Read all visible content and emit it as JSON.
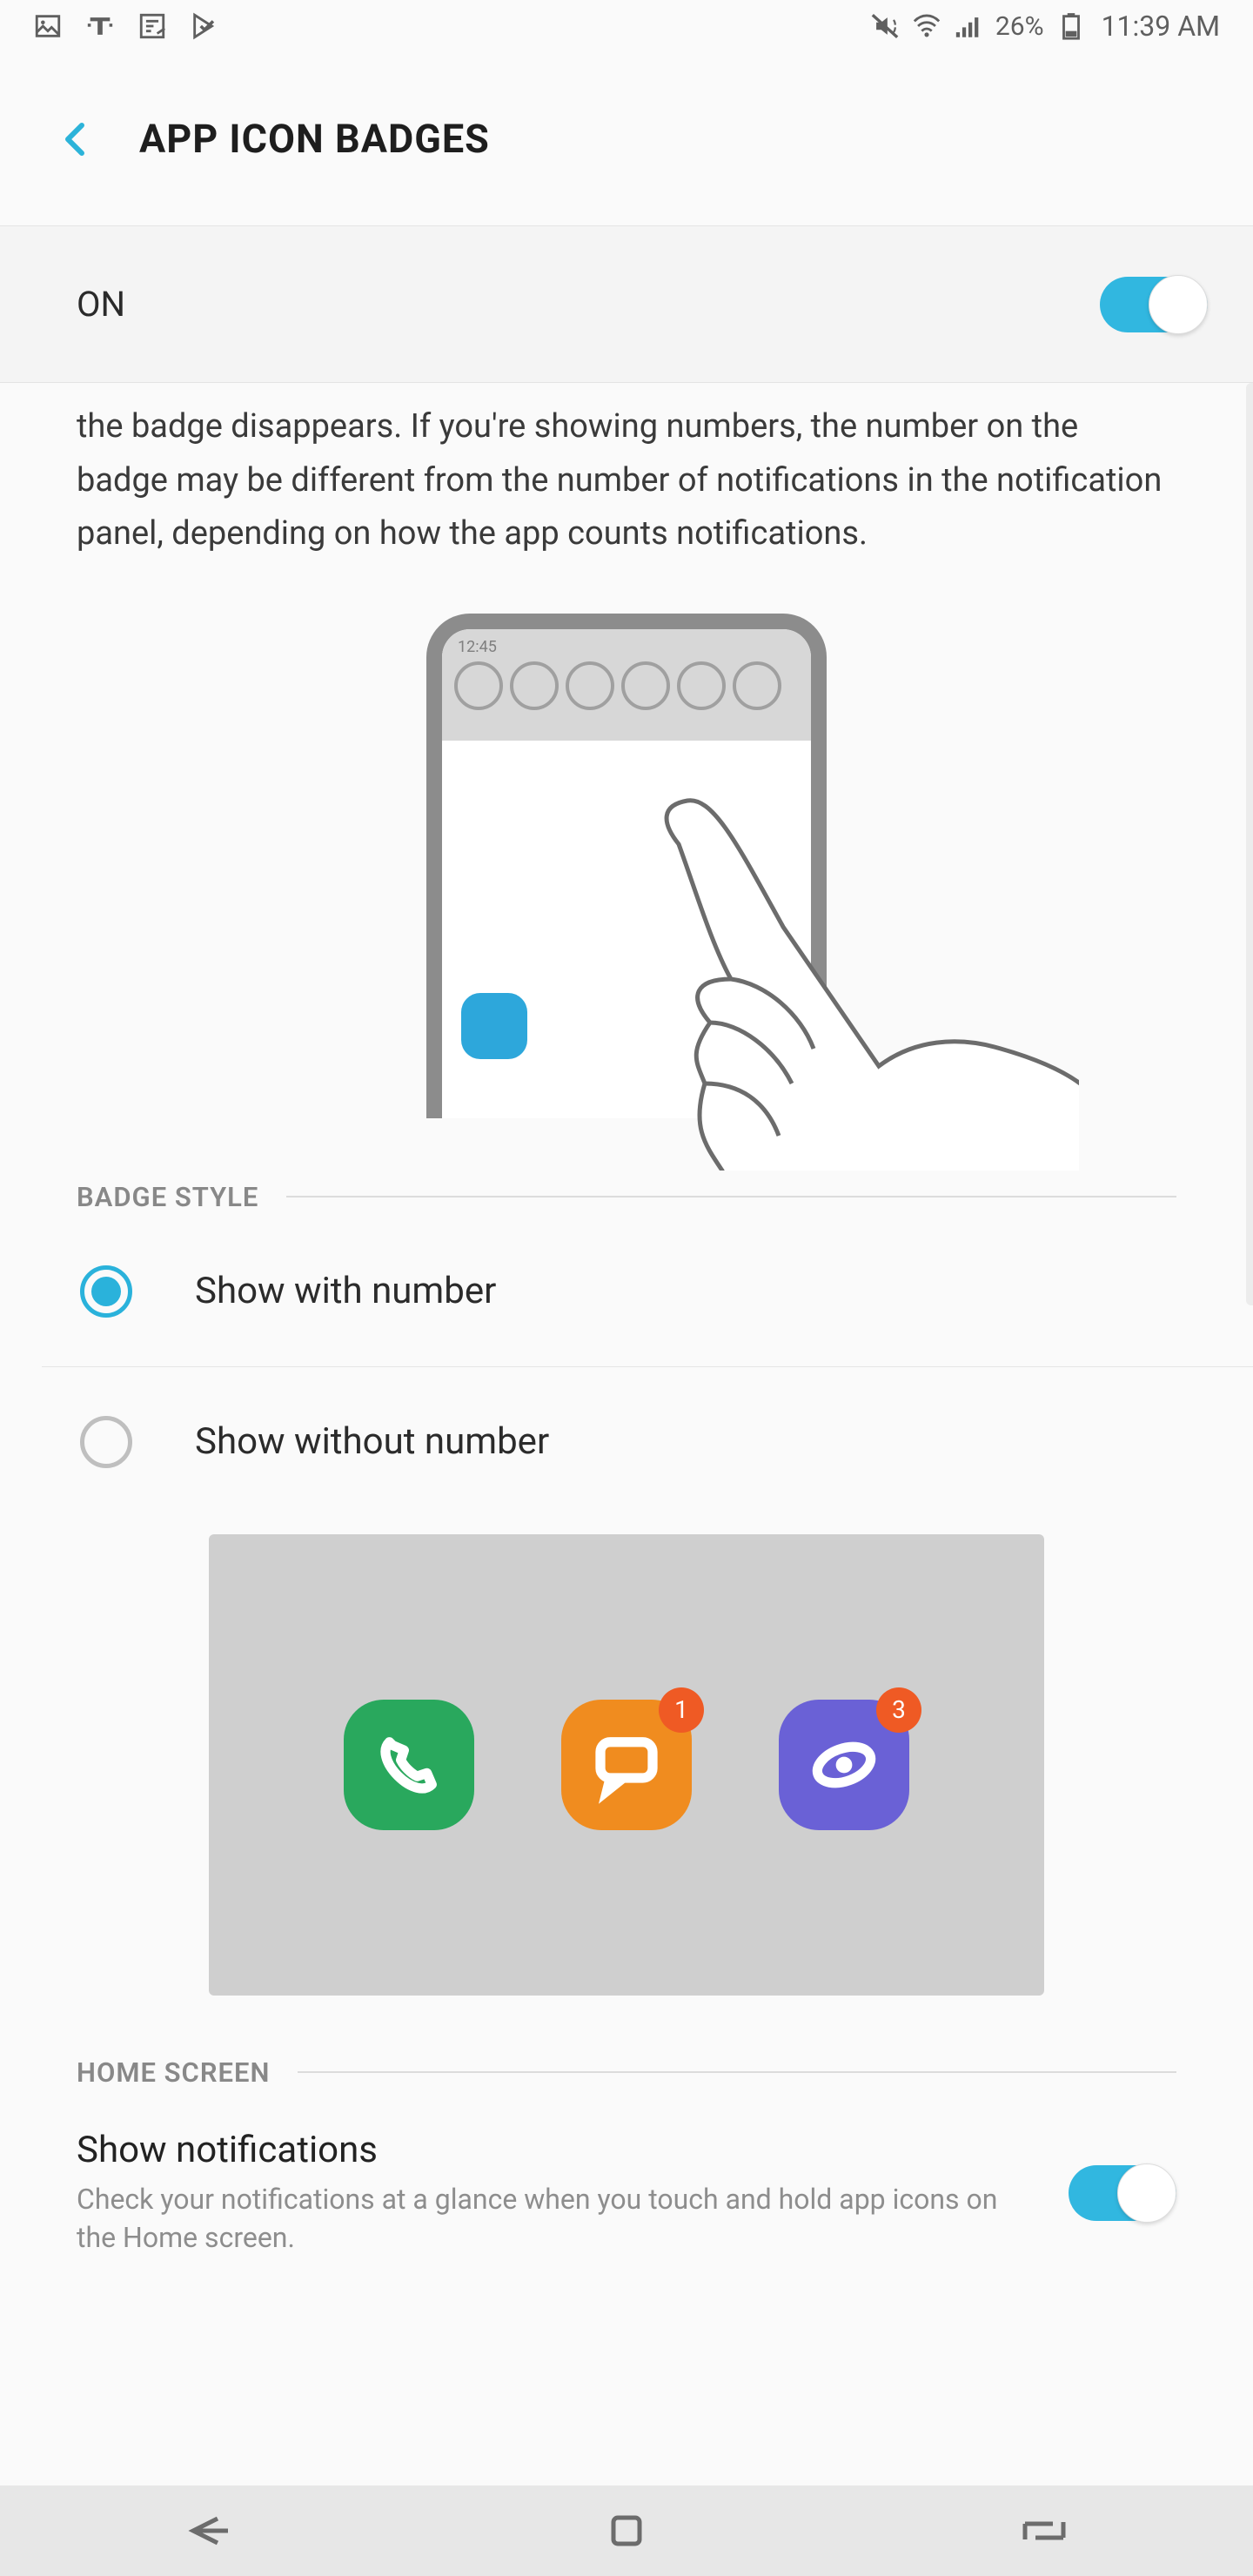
{
  "status_bar": {
    "battery_pct": "26%",
    "clock": "11:39 AM"
  },
  "header": {
    "title": "APP ICON BADGES"
  },
  "master_toggle": {
    "label": "ON",
    "enabled": true
  },
  "description": "the badge disappears. If you're showing numbers, the number on the badge may be different from the number of notifications in the notification panel, depending on how the app counts notifications.",
  "illustration": {
    "mini_time": "12:45"
  },
  "sections": {
    "badge_style": {
      "title": "BADGE STYLE",
      "options": [
        {
          "label": "Show with number",
          "selected": true
        },
        {
          "label": "Show without number",
          "selected": false
        }
      ],
      "preview_badges": [
        "1",
        "3"
      ]
    },
    "home_screen": {
      "title": "HOME SCREEN",
      "items": [
        {
          "title": "Show notifications",
          "subtitle": "Check your notifications at a glance when you touch and hold app icons on the Home screen.",
          "enabled": true
        }
      ]
    }
  }
}
